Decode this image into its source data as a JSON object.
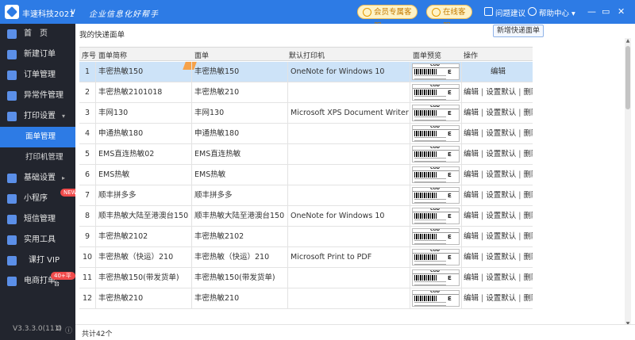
{
  "app": {
    "title": "丰速科技2021",
    "slogan": "企业信息化好帮手",
    "vip_service": "会员专属客服",
    "online_service": "在线客服",
    "feedback": "问题建议",
    "help": "帮助中心",
    "brand_color": "#2d7be5"
  },
  "sidebar": {
    "items": [
      {
        "label": "首　页",
        "icon": "home-icon"
      },
      {
        "label": "新建订单",
        "icon": "new-order-icon"
      },
      {
        "label": "订单管理",
        "icon": "order-icon"
      },
      {
        "label": "异常件管理",
        "icon": "exception-icon"
      },
      {
        "label": "打印设置",
        "icon": "print-icon",
        "expanded": true
      },
      {
        "label": "面单管理",
        "sub": true,
        "active": true
      },
      {
        "label": "打印机管理",
        "sub": true
      },
      {
        "label": "基础设置",
        "icon": "settings-icon"
      },
      {
        "label": "小程序",
        "icon": "mini-program-icon",
        "badge": "NEW"
      },
      {
        "label": "短信管理",
        "icon": "sms-icon"
      },
      {
        "label": "实用工具",
        "icon": "tools-icon"
      },
      {
        "label": "课打 VIP",
        "icon": "vip-icon"
      },
      {
        "label": "电商打单",
        "icon": "ecommerce-icon",
        "badge": "40+平台"
      }
    ],
    "version": "V3.3.3.0(111)"
  },
  "main": {
    "title": "我的快递面单",
    "add_button": "新增快递面单",
    "columns": [
      "序号",
      "面单简称",
      "面单",
      "默认打印机",
      "面单预览",
      "操作"
    ],
    "preview_cod": "COD",
    "preview_e": "E",
    "ops": {
      "edit": "编辑",
      "set_default": "设置默认",
      "delete": "删除",
      "sep": "|"
    },
    "rows": [
      {
        "no": "1",
        "name": "丰密热敏150",
        "sheet": "丰密热敏150",
        "printer": "OneNote for Windows 10",
        "selected": true,
        "ops": "edit_only"
      },
      {
        "no": "2",
        "name": "丰密热敏2101018",
        "sheet": "丰密热敏210",
        "printer": ""
      },
      {
        "no": "3",
        "name": "丰网130",
        "sheet": "丰网130",
        "printer": "Microsoft XPS Document Writer"
      },
      {
        "no": "4",
        "name": "申通热敏180",
        "sheet": "申通热敏180",
        "printer": ""
      },
      {
        "no": "5",
        "name": "EMS直连热敏02",
        "sheet": "EMS直连热敏",
        "printer": ""
      },
      {
        "no": "6",
        "name": "EMS热敏",
        "sheet": "EMS热敏",
        "printer": ""
      },
      {
        "no": "7",
        "name": "顺丰拼多多",
        "sheet": "顺丰拼多多",
        "printer": ""
      },
      {
        "no": "8",
        "name": "顺丰热敏大陆至港澳台150",
        "sheet": "顺丰热敏大陆至港澳台150",
        "printer": "OneNote for Windows 10"
      },
      {
        "no": "9",
        "name": "丰密热敏2102",
        "sheet": "丰密热敏2102",
        "printer": ""
      },
      {
        "no": "10",
        "name": "丰密热敏（快运）210",
        "sheet": "丰密热敏（快运）210",
        "printer": "Microsoft Print to PDF"
      },
      {
        "no": "11",
        "name": "丰密热敏150(带发货单)",
        "sheet": "丰密热敏150(带发货单)",
        "printer": ""
      },
      {
        "no": "12",
        "name": "丰密热敏210",
        "sheet": "丰密热敏210",
        "printer": ""
      }
    ],
    "total": "共计42个"
  }
}
